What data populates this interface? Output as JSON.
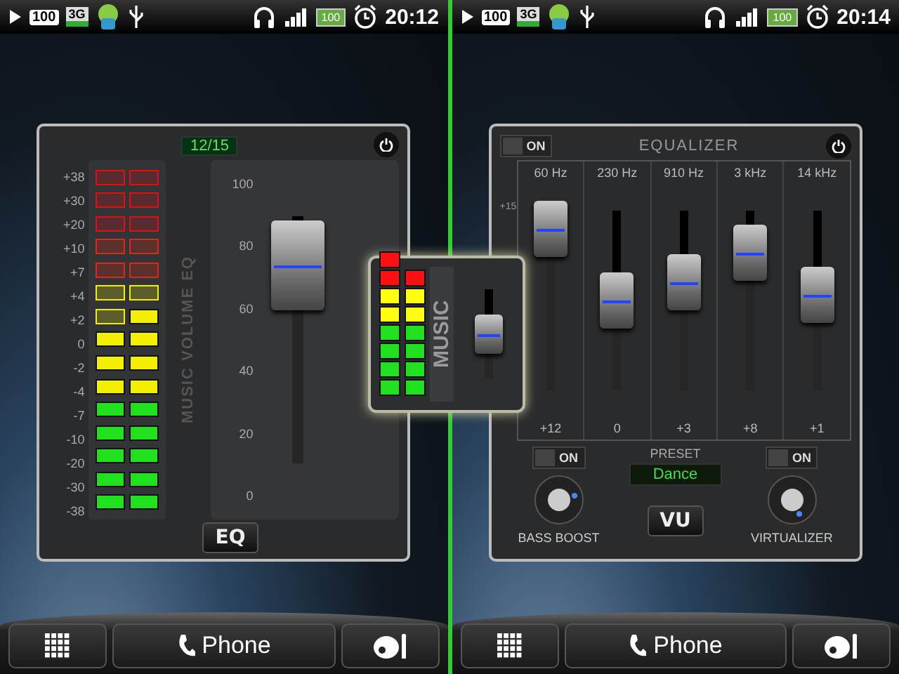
{
  "screens": [
    {
      "status_bar": {
        "notice_battery": "100",
        "network": "3G",
        "battery": "100",
        "time": "20:12"
      },
      "widget": {
        "kind": "vu",
        "counter": "12/15",
        "side_label": "MUSIC VOLUME EQ",
        "mode_button": "EQ",
        "level": 0.8,
        "ticks": [
          "100",
          "80",
          "60",
          "40",
          "20",
          "0"
        ],
        "rows": [
          {
            "label": "+38",
            "color": "#e01010",
            "left_lit": false,
            "right_lit": false
          },
          {
            "label": "+30",
            "color": "#e01010",
            "left_lit": false,
            "right_lit": false
          },
          {
            "label": "+20",
            "color": "#e01010",
            "left_lit": false,
            "right_lit": false
          },
          {
            "label": "+10",
            "color": "#e02810",
            "left_lit": false,
            "right_lit": false
          },
          {
            "label": "+7",
            "color": "#e02810",
            "left_lit": false,
            "right_lit": false
          },
          {
            "label": "+4",
            "color": "#f0f000",
            "left_lit": false,
            "right_lit": false
          },
          {
            "label": "+2",
            "color": "#f0f000",
            "left_lit": false,
            "right_lit": true
          },
          {
            "label": "0",
            "color": "#f0f000",
            "left_lit": true,
            "right_lit": true
          },
          {
            "label": "-2",
            "color": "#f0f000",
            "left_lit": true,
            "right_lit": true
          },
          {
            "label": "-4",
            "color": "#f0f000",
            "left_lit": true,
            "right_lit": true
          },
          {
            "label": "-7",
            "color": "#20e020",
            "left_lit": true,
            "right_lit": true
          },
          {
            "label": "-10",
            "color": "#20e020",
            "left_lit": true,
            "right_lit": true
          },
          {
            "label": "-20",
            "color": "#20e020",
            "left_lit": true,
            "right_lit": true
          },
          {
            "label": "-30",
            "color": "#20e020",
            "left_lit": true,
            "right_lit": true
          },
          {
            "label": "-38",
            "color": "#20e020",
            "left_lit": true,
            "right_lit": true
          }
        ]
      },
      "dock": {
        "phone": "Phone"
      }
    },
    {
      "status_bar": {
        "notice_battery": "100",
        "network": "3G",
        "battery": "100",
        "time": "20:14"
      },
      "widget": {
        "kind": "eq",
        "toggle": "ON",
        "title": "EQUALIZER",
        "scale_top": "+15",
        "bands": [
          {
            "freq": "60 Hz",
            "value": "+12",
            "level": 0.9
          },
          {
            "freq": "230 Hz",
            "value": "0",
            "level": 0.5
          },
          {
            "freq": "910 Hz",
            "value": "+3",
            "level": 0.6
          },
          {
            "freq": "3 kHz",
            "value": "+8",
            "level": 0.767
          },
          {
            "freq": "14 kHz",
            "value": "+1",
            "level": 0.533
          }
        ],
        "bass_toggle": "ON",
        "preset_label": "PRESET",
        "preset": "Dance",
        "virtualizer_toggle": "ON",
        "bass_label": "BASS BOOST",
        "mode_button": "VU",
        "virtualizer_label": "VIRTUALIZER"
      },
      "dock": {
        "phone": "Phone"
      }
    }
  ],
  "app_icon": {
    "label": "MUSIC",
    "level": 0.5,
    "columns": [
      {
        "cells": [
          {
            "color": "#ff1010"
          },
          {
            "color": "#ff1010"
          },
          {
            "color": "#ffff10"
          },
          {
            "color": "#ffff10"
          },
          {
            "color": "#20e020"
          },
          {
            "color": "#20e020"
          },
          {
            "color": "#20e020"
          },
          {
            "color": "#20e020"
          }
        ]
      },
      {
        "cells": [
          {
            "color": "#ff1010"
          },
          {
            "color": "#ffff10"
          },
          {
            "color": "#ffff10"
          },
          {
            "color": "#20e020"
          },
          {
            "color": "#20e020"
          },
          {
            "color": "#20e020"
          },
          {
            "color": "#20e020"
          }
        ]
      }
    ]
  }
}
